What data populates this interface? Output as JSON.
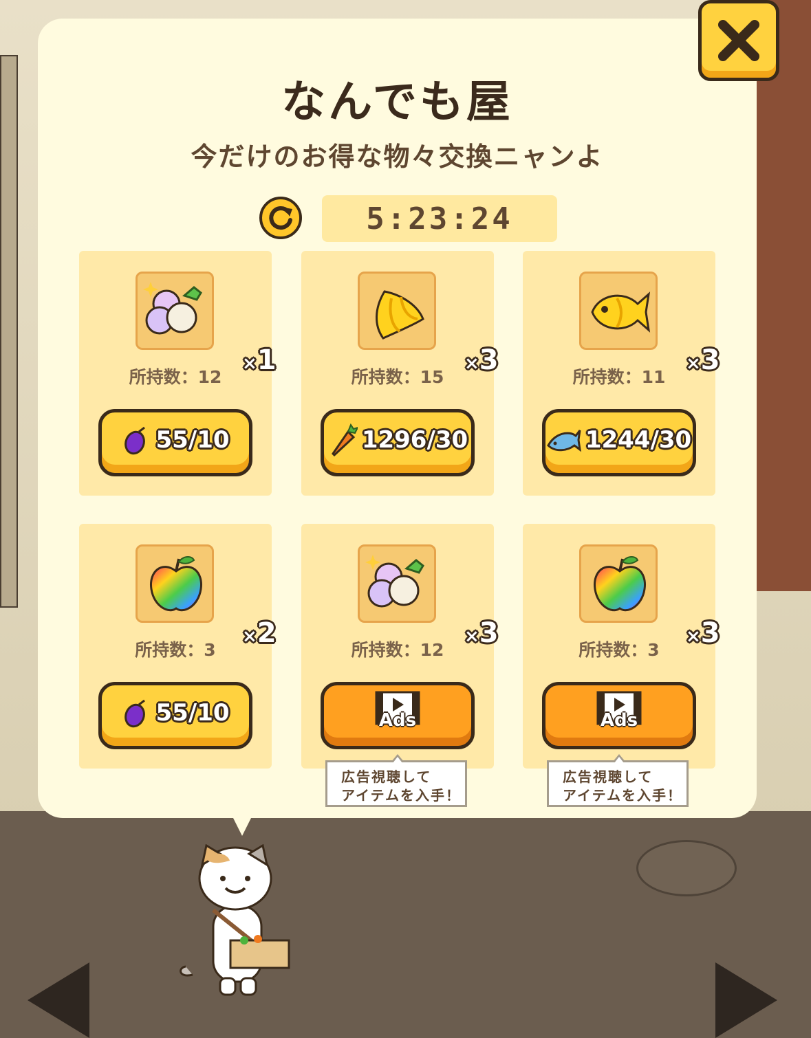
{
  "shop": {
    "title": "なんでも屋",
    "subtitle": "今だけのお得な物々交換ニャンよ",
    "timer": "5:23:24"
  },
  "icons": {
    "close": "close-x-icon",
    "refresh": "refresh-icon"
  },
  "colors": {
    "button_yellow": "#ffd23f",
    "button_orange": "#ffa020",
    "card_bg": "#ffe9a8",
    "dialog_bg": "#fffbdf"
  },
  "offers": [
    {
      "item": "rainbow-turnips",
      "quantity": "1",
      "owned": "所持数：12",
      "cost_icon": "plum-icon",
      "price": "55/10"
    },
    {
      "item": "golden-cabbage",
      "quantity": "3",
      "owned": "所持数：15",
      "cost_icon": "carrot-icon",
      "price": "1296/30"
    },
    {
      "item": "golden-fish",
      "quantity": "3",
      "owned": "所持数：11",
      "cost_icon": "fish-icon",
      "price": "1244/30"
    },
    {
      "item": "rainbow-apple",
      "quantity": "2",
      "owned": "所持数：3",
      "cost_icon": "plum-icon",
      "price": "55/10"
    },
    {
      "item": "rainbow-turnips",
      "quantity": "3",
      "owned": "所持数：12",
      "cost_icon": "video-ad-icon",
      "price": "Ads",
      "tooltip": [
        "広告視聴して",
        "アイテムを入手！"
      ]
    },
    {
      "item": "rainbow-apple",
      "quantity": "3",
      "owned": "所持数：3",
      "cost_icon": "video-ad-icon",
      "price": "Ads",
      "tooltip": [
        "広告視聴して",
        "アイテムを入手！"
      ]
    }
  ],
  "quantity_prefix": "×"
}
